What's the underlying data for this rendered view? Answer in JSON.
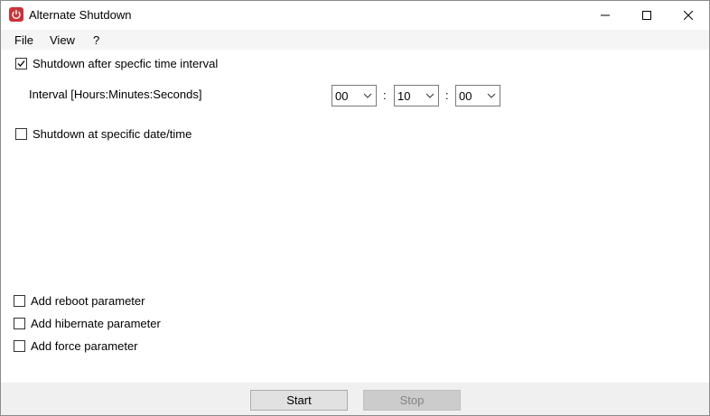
{
  "window": {
    "title": "Alternate Shutdown",
    "app_icon": "power-icon",
    "controls": [
      "minimize-icon",
      "maximize-icon",
      "close-icon"
    ]
  },
  "menu": {
    "file": "File",
    "view": "View",
    "help": "?"
  },
  "timer_option": {
    "label": "Shutdown after specfic time interval",
    "checked": true
  },
  "interval": {
    "label": "Interval [Hours:Minutes:Seconds]",
    "hours": "00",
    "minutes": "10",
    "seconds": "00",
    "separator": ":"
  },
  "datetime_option": {
    "label": "Shutdown at specific date/time",
    "checked": false
  },
  "parameters": {
    "reboot": {
      "label": "Add reboot parameter",
      "checked": false
    },
    "hibernate": {
      "label": "Add hibernate parameter",
      "checked": false
    },
    "force": {
      "label": "Add force parameter",
      "checked": false
    }
  },
  "buttons": {
    "start": "Start",
    "stop": "Stop",
    "stop_enabled": false
  },
  "colors": {
    "app_icon_bg": "#c8343a",
    "menubar_bg": "#f5f5f5",
    "footer_bg": "#f0f0f0",
    "button_bg": "#e1e1e1",
    "disabled_button_bg": "#cccccc"
  }
}
